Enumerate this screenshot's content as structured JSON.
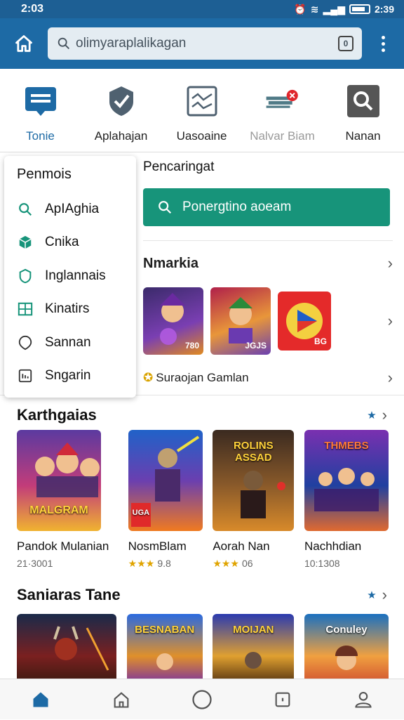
{
  "status": {
    "left_time": "2:03",
    "right_time": "2:39"
  },
  "search": {
    "placeholder": "olimyaraplalikagan",
    "lens_label": "0"
  },
  "categories": [
    {
      "label": "Tonie",
      "icon": "chat-icon"
    },
    {
      "label": "Aplahajan",
      "icon": "check-badge-icon"
    },
    {
      "label": "Uasoaine",
      "icon": "chart-icon"
    },
    {
      "label": "Nalvar Biam",
      "icon": "notification-icon"
    },
    {
      "label": "Nanan",
      "icon": "search-icon"
    }
  ],
  "dropdown": {
    "title": "Penmois",
    "items": [
      {
        "label": "ApIAghia",
        "icon": "search-icon"
      },
      {
        "label": "Cnika",
        "icon": "cube-icon"
      },
      {
        "label": "Inglannais",
        "icon": "shield-icon"
      },
      {
        "label": "Kinatirs",
        "icon": "grid-icon"
      },
      {
        "label": "Sannan",
        "icon": "pin-icon"
      },
      {
        "label": "Sngarin",
        "icon": "document-icon"
      }
    ]
  },
  "right_pane": {
    "title": "Pencaringat",
    "search_button": "Ponergtino aoeam",
    "section_title": "Nmarkia",
    "thumb_tags": [
      "780",
      "JGJS",
      "BG"
    ],
    "footer_label": "Suraojan Gamlan"
  },
  "section1": {
    "title": "Karthgaias",
    "games": [
      {
        "name": "Pandok Mulanian",
        "meta": "21·3001",
        "art_text": "MALGRAM",
        "stars": "",
        "rating": ""
      },
      {
        "name": "NosmBlam",
        "meta": "",
        "art_text": "UGA",
        "stars": "★★★",
        "rating": "9.8"
      },
      {
        "name": "Aorah Nan",
        "meta": "",
        "art_text": "ROLINS ASSAD",
        "stars": "★★★",
        "rating": "06"
      },
      {
        "name": "Nachhdian",
        "meta": "10:1308",
        "art_text": "THMEBS",
        "stars": "",
        "rating": ""
      }
    ]
  },
  "section2": {
    "title": "Saniaras Tane",
    "games": [
      {
        "art_text": ""
      },
      {
        "art_text": "BESNABAN"
      },
      {
        "art_text": "MOIJAN"
      },
      {
        "art_text": "Conuley"
      }
    ]
  },
  "colors": {
    "primary": "#1d6aa5",
    "accent_green": "#17947a",
    "star": "#e0a400"
  }
}
